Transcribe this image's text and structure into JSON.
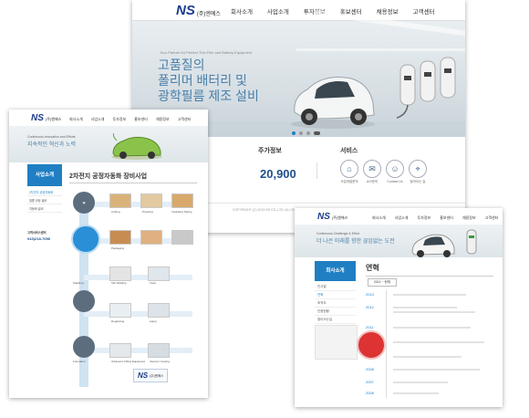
{
  "main_site": {
    "logo": {
      "mark": "NS",
      "name": "(주)엔에스"
    },
    "nav": [
      "회사소개",
      "사업소개",
      "투자정보",
      "홍보센터",
      "채용정보",
      "고객센터"
    ],
    "hero": {
      "small": "Your Partner for Perfect Thin Film and Battery Equipment",
      "headline": [
        "고품질의",
        "폴리머 배터리 및",
        "광학필름 제조 설비"
      ]
    },
    "stock": {
      "label": "주가정보",
      "value": "20,900"
    },
    "service": {
      "label": "서비스",
      "items": [
        "사업개발문의",
        "A/S문의",
        "Contact Us",
        "찾아오는 길"
      ]
    },
    "footer": "COPYRIGHT (C) 2013 NS CO.,LTD. ALL RIGHTS RESERVED."
  },
  "business_page": {
    "logo": {
      "mark": "NS",
      "name": "(주)엔에스"
    },
    "nav": [
      "회사소개",
      "사업소개",
      "투자정보",
      "홍보센터",
      "채용정보",
      "고객센터"
    ],
    "banner": {
      "line1": "Continuous Innovation and Efforts",
      "line2": "지속적인 혁신과 노력"
    },
    "sidebar": {
      "title": "사업소개",
      "items": [
        "2차전지 공정자동화",
        "필름 코팅 설비",
        "자동화 설비"
      ],
      "contact_label": "고객서비스센터",
      "phone": "043)218-7058"
    },
    "content_title": "2차전지 공정자동화 장비사업",
    "process_steps": [
      "Cutting",
      "Pressing",
      "Insulating Taping",
      "Packaging",
      "Stacking",
      "Tab Welding",
      "Case",
      "Degassing",
      "Formation",
      "Aging",
      "Ultrasonic Filling Equipment",
      "Vacuum Cooling"
    ]
  },
  "history_page": {
    "logo": {
      "mark": "NS",
      "name": "(주)엔에스"
    },
    "nav": [
      "회사소개",
      "사업소개",
      "투자정보",
      "홍보센터",
      "채용정보",
      "고객센터"
    ],
    "banner": {
      "line1": "Continuous Challenge & Effort",
      "line2": "더 나은 미래를 향한 끊임없는 도전"
    },
    "sidebar": {
      "title": "회사소개",
      "items": [
        "인사말",
        "연혁",
        "조직도",
        "인증현황",
        "찾아오는길"
      ]
    },
    "content_title": "연혁",
    "tabs": [
      "2011 ~ 현재"
    ],
    "years": [
      "2013",
      "2012",
      "2011",
      "2010",
      "2009",
      "2008",
      "2007",
      "2006"
    ]
  }
}
